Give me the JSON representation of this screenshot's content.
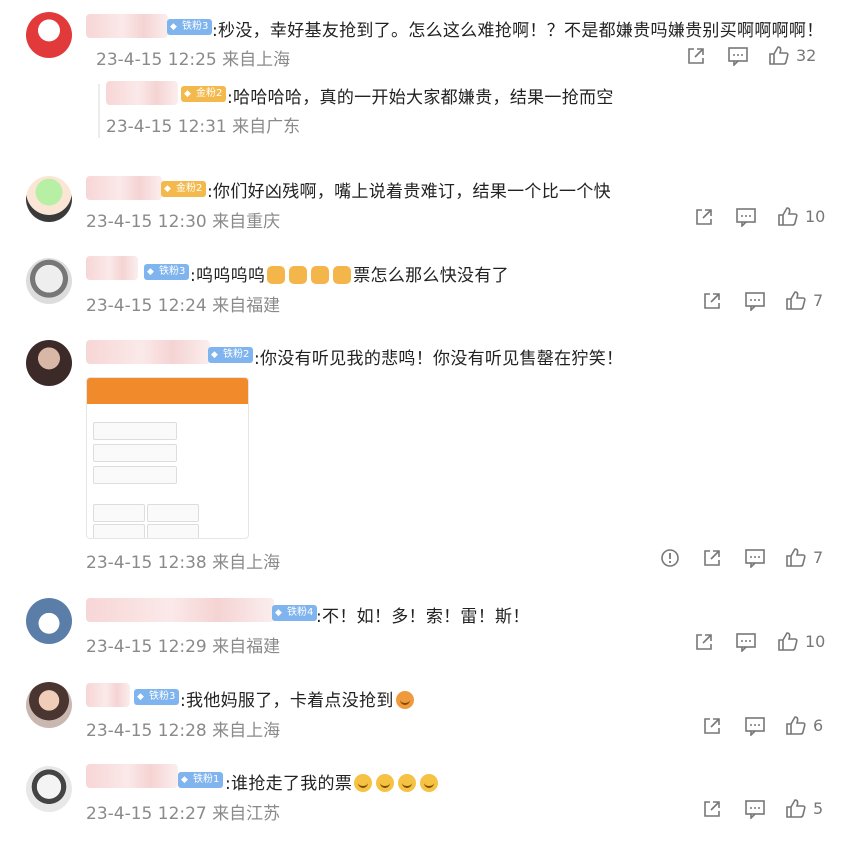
{
  "comments": [
    {
      "badge": "铁粉3",
      "text": ":秒没，幸好基友抢到了。怎么这么难抢啊！？不是都嫌贵吗嫌贵别买啊啊啊啊！",
      "meta": "23-4-15 12:25 来自上海",
      "likes": "32",
      "reply": {
        "badge": "金粉2",
        "text": ":哈哈哈哈，真的一开始大家都嫌贵，结果一抢而空",
        "meta": "23-4-15 12:31 来自广东"
      }
    },
    {
      "badge": "金粉2",
      "text": ":你们好凶残啊，嘴上说着贵难订，结果一个比一个快",
      "meta": "23-4-15 12:30 来自重庆",
      "likes": "10"
    },
    {
      "badge": "铁粉3",
      "text": ":呜呜呜呜",
      "text_tail": "票怎么那么快没有了",
      "meta": "23-4-15 12:24 来自福建",
      "likes": "7"
    },
    {
      "badge": "铁粉2",
      "text": ":你没有听见我的悲鸣！你没有听见售罄在狞笑！",
      "meta": "23-4-15 12:38 来自上海",
      "likes": "7"
    },
    {
      "badge": "铁粉4",
      "text": ":不！如！多！索！雷！斯！",
      "meta": "23-4-15 12:29 来自福建",
      "likes": "10"
    },
    {
      "badge": "铁粉3",
      "text": ":我他妈服了，卡着点没抢到",
      "meta": "23-4-15 12:28 来自上海",
      "likes": "6"
    },
    {
      "badge": "铁粉1",
      "text": ":谁抢走了我的票",
      "meta": "23-4-15 12:27 来自江苏",
      "likes": "5"
    }
  ],
  "icons": {
    "share": "share-icon",
    "comment": "comment-icon",
    "like": "thumbs-up-icon",
    "report": "report-icon"
  },
  "colors": {
    "iron_badge": "#7fb4ee",
    "gold_badge": "#f3b94c",
    "attachment_header": "#f08a2b"
  }
}
